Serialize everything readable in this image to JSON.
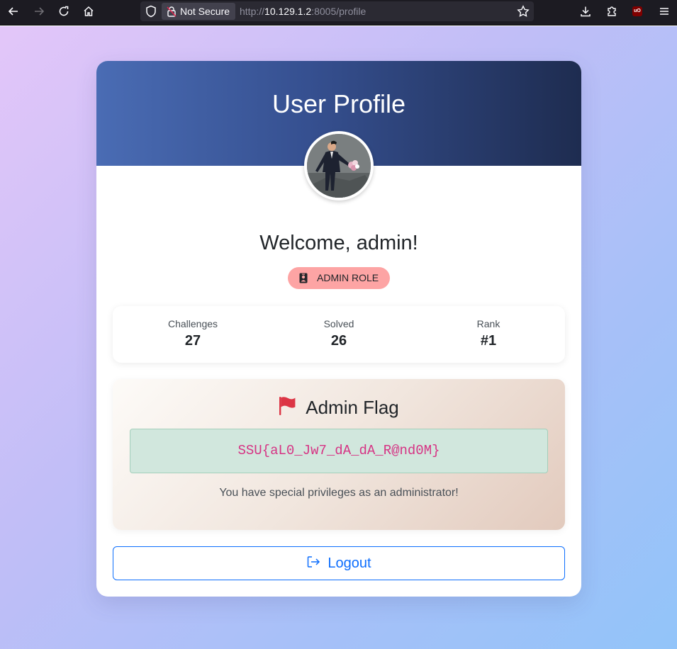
{
  "browser": {
    "security_label": "Not Secure",
    "url_scheme": "http://",
    "url_host": "10.129.1.2",
    "url_rest": ":8005/profile"
  },
  "profile": {
    "title": "User Profile",
    "welcome": "Welcome, admin!",
    "role_badge": "ADMIN ROLE",
    "stats": [
      {
        "label": "Challenges",
        "value": "27"
      },
      {
        "label": "Solved",
        "value": "26"
      },
      {
        "label": "Rank",
        "value": "#1"
      }
    ],
    "flag_section": {
      "title": "Admin Flag",
      "flag": "SSU{aL0_Jw7_dA_dA_R@nd0M}",
      "note": "You have special privileges as an administrator!"
    },
    "logout_label": "Logout"
  },
  "colors": {
    "header_gradient_start": "#4a6cb4",
    "header_gradient_end": "#1e2c50",
    "badge_bg": "#fda4a4",
    "flag_box_bg": "#d1e7dd",
    "flag_text": "#d63384",
    "logout_accent": "#0d6efd",
    "flag_icon": "#dc3545"
  },
  "icons": {
    "back": "arrow-left-icon",
    "forward": "arrow-right-icon",
    "reload": "reload-icon",
    "home": "home-icon",
    "shield": "shield-icon",
    "lock": "lock-slash-icon",
    "bookmark": "star-icon",
    "download": "download-icon",
    "extensions": "puzzle-icon",
    "ublock": "ublock-icon",
    "menu": "hamburger-icon",
    "role": "id-badge-icon",
    "flag": "flag-icon",
    "logout": "logout-icon"
  }
}
